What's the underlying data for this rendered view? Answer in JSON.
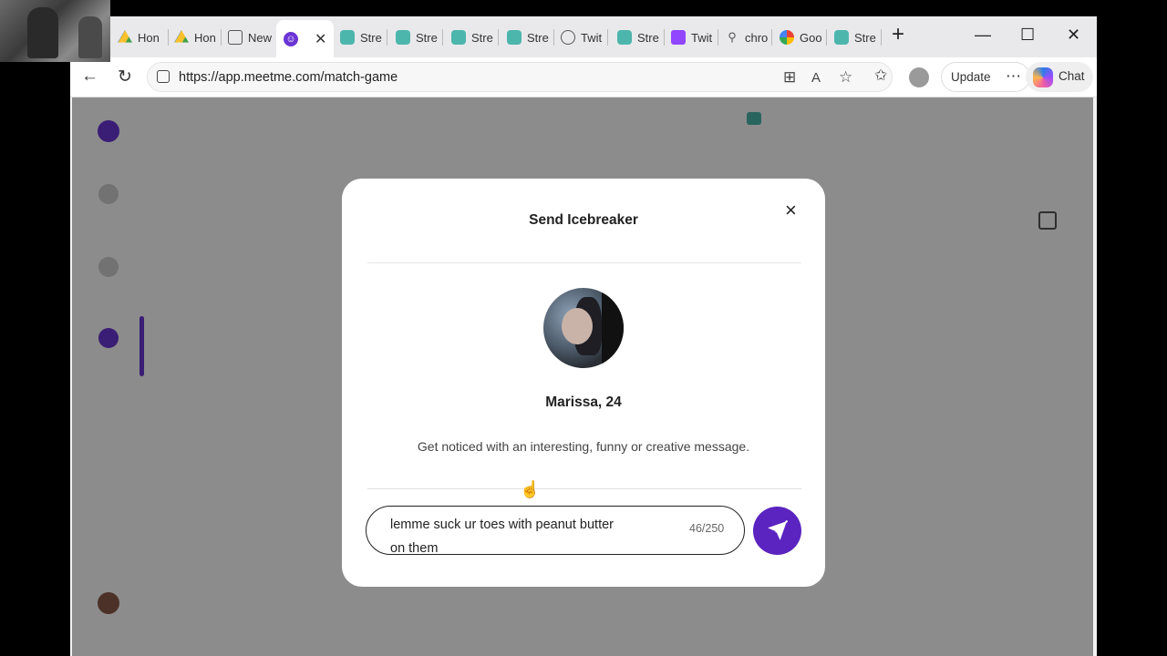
{
  "browser": {
    "tabs": [
      {
        "label": "Hon",
        "icon": "google-drive-icon"
      },
      {
        "label": "Hon",
        "icon": "google-drive-icon"
      },
      {
        "label": "New",
        "icon": "news-icon"
      },
      {
        "label": "",
        "icon": "meetme-icon",
        "active": true
      },
      {
        "label": "Stre",
        "icon": "stream-icon"
      },
      {
        "label": "Stre",
        "icon": "stream-icon"
      },
      {
        "label": "Stre",
        "icon": "stream-icon"
      },
      {
        "label": "Stre",
        "icon": "stream-icon"
      },
      {
        "label": "Twit",
        "icon": "globe-icon"
      },
      {
        "label": "Stre",
        "icon": "stream-icon"
      },
      {
        "label": "Twit",
        "icon": "twitch-icon"
      },
      {
        "label": "chro",
        "icon": "search-icon"
      },
      {
        "label": "Goo",
        "icon": "google-icon"
      },
      {
        "label": "Stre",
        "icon": "stream-icon"
      }
    ],
    "new_tab_label": "+",
    "url": "https://app.meetme.com/match-game",
    "update_label": "Update",
    "chat_label": "Chat"
  },
  "modal": {
    "title": "Send Icebreaker",
    "close_label": "×",
    "profile_name": "Marissa, 24",
    "hint": "Get noticed with an interesting, funny or creative message.",
    "message_line1": "lemme suck ur toes with peanut butter",
    "message_line2": "on them",
    "counter": "46/250"
  },
  "colors": {
    "brand": "#5b24c0",
    "overlay": "rgba(0,0,0,0.45)"
  }
}
